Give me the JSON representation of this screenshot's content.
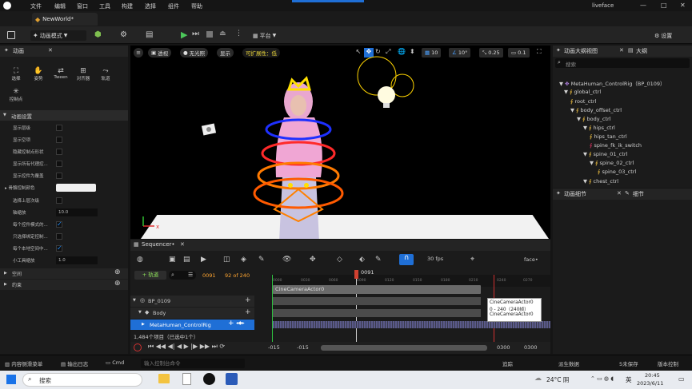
{
  "title_bar": {
    "menus": [
      "文件",
      "编辑",
      "窗口",
      "工具",
      "构建",
      "选择",
      "组件",
      "帮助"
    ],
    "project": "liveface",
    "minimize": "—",
    "maximize": "□",
    "close": "✕"
  },
  "tab": {
    "label": "NewWorld*"
  },
  "toolbar": {
    "mode": "动画模式",
    "platform": "平台",
    "settings": "设置"
  },
  "left_panel": {
    "title": "动画",
    "tools": [
      "选择",
      "姿势",
      "Tween",
      "对齐器",
      "轨道"
    ],
    "tool_extra": "控制点",
    "section": "动画设置",
    "rows": [
      {
        "label": "显示层级",
        "type": "check",
        "checked": false
      },
      {
        "label": "显示空项",
        "type": "check",
        "checked": false
      },
      {
        "label": "隐藏控制点形状",
        "type": "check",
        "checked": false
      },
      {
        "label": "显示所有代理控...",
        "type": "check",
        "checked": false
      },
      {
        "label": "显示控件为覆盖",
        "type": "check",
        "checked": false
      },
      {
        "label": "▸ 骨骼控制颜色",
        "type": "color"
      },
      {
        "label": "选择上层次级",
        "type": "check",
        "checked": false
      },
      {
        "label": "轴缩放",
        "type": "value",
        "value": "10.0"
      },
      {
        "label": "每个控件模式的...",
        "type": "check",
        "checked": true
      },
      {
        "label": "只选择绑定控制...",
        "type": "check",
        "checked": false
      },
      {
        "label": "每个本地空间中...",
        "type": "check",
        "checked": true
      },
      {
        "label": "小工具缩放",
        "type": "value",
        "value": "1.0"
      }
    ],
    "sections2": [
      "空间",
      "约束"
    ]
  },
  "viewport": {
    "perspective": "透视",
    "lit": "无光照",
    "show": "显示",
    "scalability": "可扩展性：低",
    "grid": "10",
    "angle": "10°",
    "scale": "0.25",
    "speed": "0.1"
  },
  "outliner": {
    "title": "动画大纲视图",
    "tab2": "大纲",
    "search_placeholder": "搜索",
    "items": [
      {
        "label": "MetaHuman_ControlRig（BP_0109）",
        "depth": 0
      },
      {
        "label": "global_ctrl",
        "depth": 1
      },
      {
        "label": "root_ctrl",
        "depth": 2
      },
      {
        "label": "body_offset_ctrl",
        "depth": 2
      },
      {
        "label": "body_ctrl",
        "depth": 3
      },
      {
        "label": "hips_ctrl",
        "depth": 4
      },
      {
        "label": "hips_tan_ctrl",
        "depth": 5
      },
      {
        "label": "spine_fk_ik_switch",
        "depth": 5
      },
      {
        "label": "spine_01_ctrl",
        "depth": 5
      },
      {
        "label": "spine_02_ctrl",
        "depth": 6
      },
      {
        "label": "spine_03_ctrl",
        "depth": 7
      },
      {
        "label": "chest_ctrl",
        "depth": 6
      }
    ]
  },
  "details": {
    "title": "动画细节",
    "tab2": "细节"
  },
  "sequencer": {
    "title": "Sequencer•",
    "fps": "30 fps",
    "track_btn": "+ 轨道",
    "frame": "0091",
    "range": "92 of 240",
    "face_label": "face•",
    "playhead": "0091",
    "ruler": [
      "0000",
      "0030",
      "0060",
      "0090",
      "0120",
      "0150",
      "0180",
      "0210",
      "0240",
      "0270"
    ],
    "tracks": [
      {
        "label": "BP_0109"
      },
      {
        "label": "Body"
      },
      {
        "label": "MetaHuman_ControlRig"
      }
    ],
    "camera_clip": "CineCameraActor0",
    "count": "1,484个项目（已选中1个）",
    "tooltip": [
      "CineCameraActor0",
      "0 - 240（240帧）",
      "CineCameraActor0"
    ],
    "bottom": [
      "-015",
      "-015",
      "0300",
      "0300"
    ]
  },
  "status_bar": {
    "items": [
      "内容侧滑菜单",
      "输出日志",
      "Cmd"
    ],
    "console_placeholder": "输入控制台命令",
    "right": [
      "追踪",
      "派生数据",
      "5未保存",
      "版本控制"
    ]
  },
  "taskbar": {
    "search": "搜索",
    "weather": "24°C 阴",
    "lang": "英",
    "time": "20:45",
    "date": "2023/6/11"
  }
}
